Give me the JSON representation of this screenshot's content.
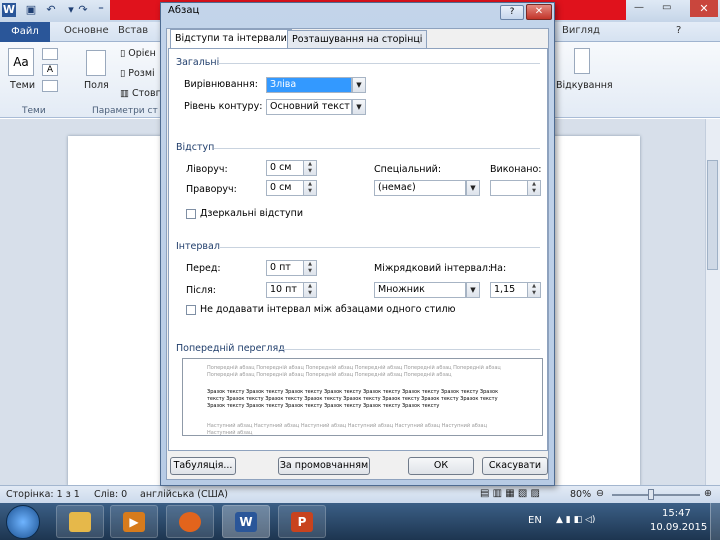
{
  "word": {
    "tabs": [
      "Файл",
      "Основне",
      "Встав",
      "Вигляд"
    ],
    "ribbon_items": [
      "Теми",
      "Поля",
      "Орієн",
      "Розмі",
      "Стовп",
      "Відкування"
    ],
    "groups": [
      "Теми",
      "Параметри ст"
    ],
    "status": {
      "page": "Сторінка: 1 з 1",
      "words": "Слів: 0",
      "language": "англійська (США)",
      "zoom": "80%"
    }
  },
  "dialog": {
    "title": "Абзац",
    "close_symbol": "✕",
    "tabs": [
      "Відступи та інтервали",
      "Розташування на сторінці"
    ],
    "general": {
      "section": "Загальні",
      "alignment_label": "Вирівнювання:",
      "alignment_value": "Зліва",
      "outline_label": "Рівень контуру:",
      "outline_value": "Основний текст"
    },
    "indent": {
      "section": "Відступ",
      "left_label": "Ліворуч:",
      "left_value": "0 см",
      "right_label": "Праворуч:",
      "right_value": "0 см",
      "special_label": "Спеціальний:",
      "special_value": "(немає)",
      "by_label": "Виконано:",
      "by_value": "",
      "mirror_label": "Дзеркальні відступи"
    },
    "spacing": {
      "section": "Інтервал",
      "before_label": "Перед:",
      "before_value": "0 пт",
      "after_label": "Після:",
      "after_value": "10 пт",
      "line_label": "Міжрядковий інтервал:",
      "line_value": "Множник",
      "at_label": "На:",
      "at_value": "1,15",
      "dont_add_label": "Не додавати інтервал між абзацами одного стилю"
    },
    "preview": {
      "section": "Попередній перегляд",
      "prev_text": "Попередній абзац Попередній абзац Попередній абзац Попередній абзац Попередній абзац Попередній абзац Попередній абзац Попередній абзац Попередній абзац Попередній абзац Попередній абзац",
      "sample_text": "Зразок тексту Зразок тексту Зразок тексту Зразок тексту Зразок тексту Зразок тексту Зразок тексту Зразок тексту Зразок тексту Зразок тексту Зразок тексту Зразок тексту Зразок тексту Зразок тексту Зразок тексту Зразок тексту Зразок тексту Зразок тексту Зразок тексту Зразок тексту Зразок тексту",
      "next_text": "Наступний абзац Наступний абзац Наступний абзац Наступний абзац Наступний абзац Наступний абзац Наступний абзац"
    },
    "buttons": {
      "tabs": "Табуляція...",
      "default": "За промовчанням",
      "ok": "ОК",
      "cancel": "Скасувати"
    }
  },
  "taskbar": {
    "language": "EN",
    "time": "15:47",
    "date": "10.09.2015"
  },
  "colors": {
    "title_red": "#e0121c",
    "file_tab": "#2a5699",
    "alignment_highlight": "#3399ff"
  }
}
